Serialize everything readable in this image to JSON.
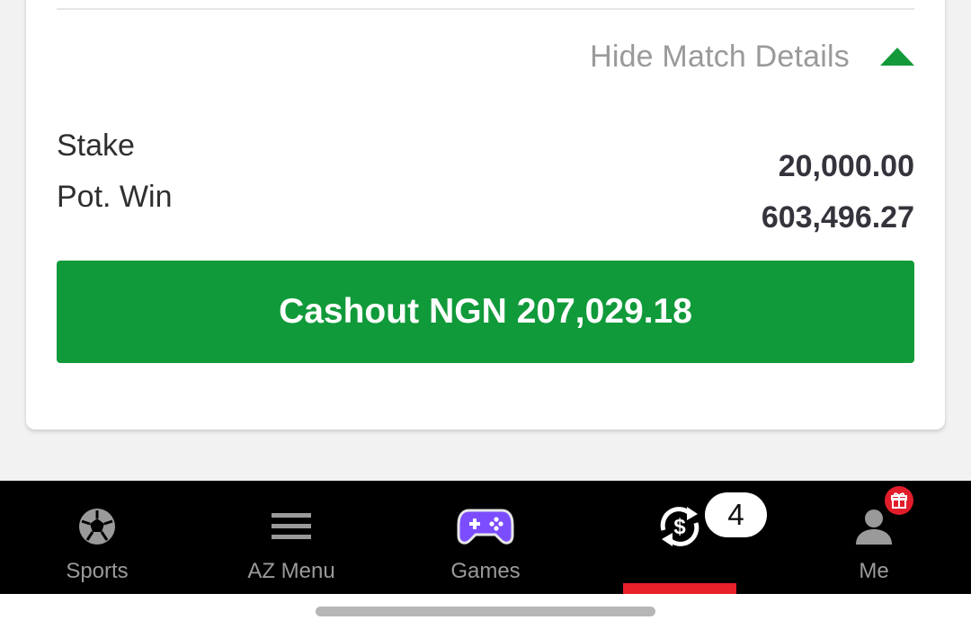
{
  "match_details": {
    "toggle_label": "Hide Match Details",
    "toggle_icon": "caret-up-icon"
  },
  "summary": {
    "stake_label": "Stake",
    "potwin_label": "Pot. Win",
    "stake_value": "20,000.00",
    "potwin_value": "603,496.27"
  },
  "cashout": {
    "prefix": "Cashout",
    "currency": "NGN",
    "amount": "207,029.18"
  },
  "bottom_nav": {
    "items": [
      {
        "label": "Sports",
        "icon": "soccer-ball-icon"
      },
      {
        "label": "AZ Menu",
        "icon": "menu-icon"
      },
      {
        "label": "Games",
        "icon": "gamepad-icon"
      },
      {
        "label": "",
        "icon": "cashout-icon",
        "badge": "4",
        "active": true
      },
      {
        "label": "Me",
        "icon": "user-icon",
        "badge_icon": "gift-icon"
      }
    ]
  },
  "colors": {
    "primary_green": "#119a3a",
    "active_red": "#e8202a",
    "games_purple": "#7c4dff"
  }
}
